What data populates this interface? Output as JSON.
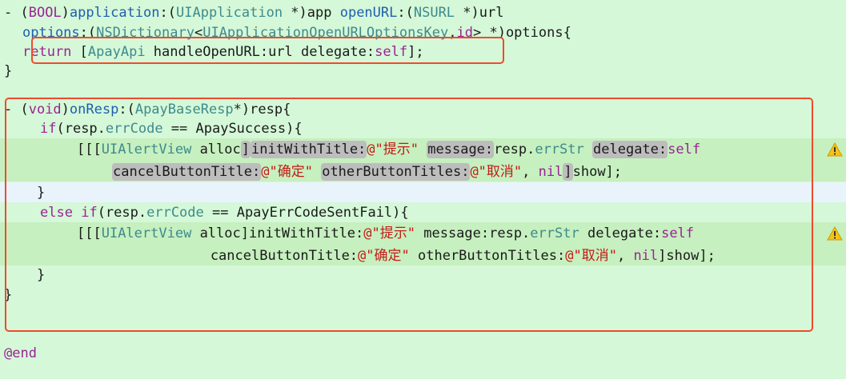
{
  "lines": {
    "l1": {
      "a": "- (",
      "b": "BOOL",
      "c": ")",
      "d": "application",
      "e": ":(",
      "f": "UIApplication",
      "g": " *)app ",
      "h": "openURL",
      "i": ":(",
      "j": "NSURL",
      "k": " *)url"
    },
    "l2": {
      "a": "  ",
      "b": "options",
      "c": ":(",
      "d": "NSDictionary",
      "e": "<",
      "f": "UIApplicationOpenURLOptionsKey",
      "g": ",",
      "h": "id",
      "i": "> *)options{"
    },
    "l3": {
      "a": "  ",
      "b": "return",
      "c": " [",
      "d": "ApayApi",
      "e": " handleOpenURL:url delegate:",
      "f": "self",
      "g": "];"
    },
    "l4": "}",
    "l5": {
      "a": "- (",
      "b": "void",
      "c": ")",
      "d": "onResp",
      "e": ":(",
      "f": "ApayBaseResp",
      "g": "*)resp{"
    },
    "l6": {
      "a": "    ",
      "b": "if",
      "c": "(resp.",
      "d": "errCode",
      "e": " == ApaySuccess){"
    },
    "l7": {
      "a": "        [[[",
      "b": "UIAlertView",
      "c": " ",
      "d": "alloc",
      "e": "]",
      "f": "initWithTitle:",
      "g": "@\"提示\"",
      "h": " ",
      "i": "message:",
      "j": "resp.",
      "k": "errStr",
      "l": " ",
      "m": "delegate:",
      "n": "self"
    },
    "l8": {
      "a": "            ",
      "b": "cancelButtonTitle:",
      "c": "@\"确定\"",
      "d": " ",
      "e": "otherButtonTitles:",
      "f": "@\"取消\"",
      "g": ", ",
      "h": "nil",
      "i": "]",
      "j": "show];"
    },
    "l9": "    }",
    "l10": {
      "a": "    ",
      "b": "else",
      "c": " ",
      "d": "if",
      "e": "(resp.",
      "f": "errCode",
      "g": " == ApayErrCodeSentFail){"
    },
    "l11": {
      "a": "        [[[",
      "b": "UIAlertView",
      "c": " ",
      "d": "alloc",
      "e": "]initWithTitle:",
      "f": "@\"提示\"",
      "g": " message:resp.",
      "h": "errStr",
      "i": " delegate:",
      "j": "self"
    },
    "l12": {
      "a": "            cancelButtonTitle:",
      "b": "@\"确定\"",
      "c": " otherButtonTitles:",
      "d": "@\"取消\"",
      "e": ", ",
      "f": "nil",
      "g": "]show];"
    },
    "l13": "    }",
    "l14": "}",
    "l15": "@end"
  },
  "colors": {
    "background": "#d5f8d8",
    "warning_highlight": "#c6f0bf",
    "annotation_box": "#f04a2e",
    "keyword": "#9b2393",
    "type": "#3e8a8d",
    "string": "#c41a16"
  },
  "icons": {
    "warning": "warning-triangle-icon"
  }
}
